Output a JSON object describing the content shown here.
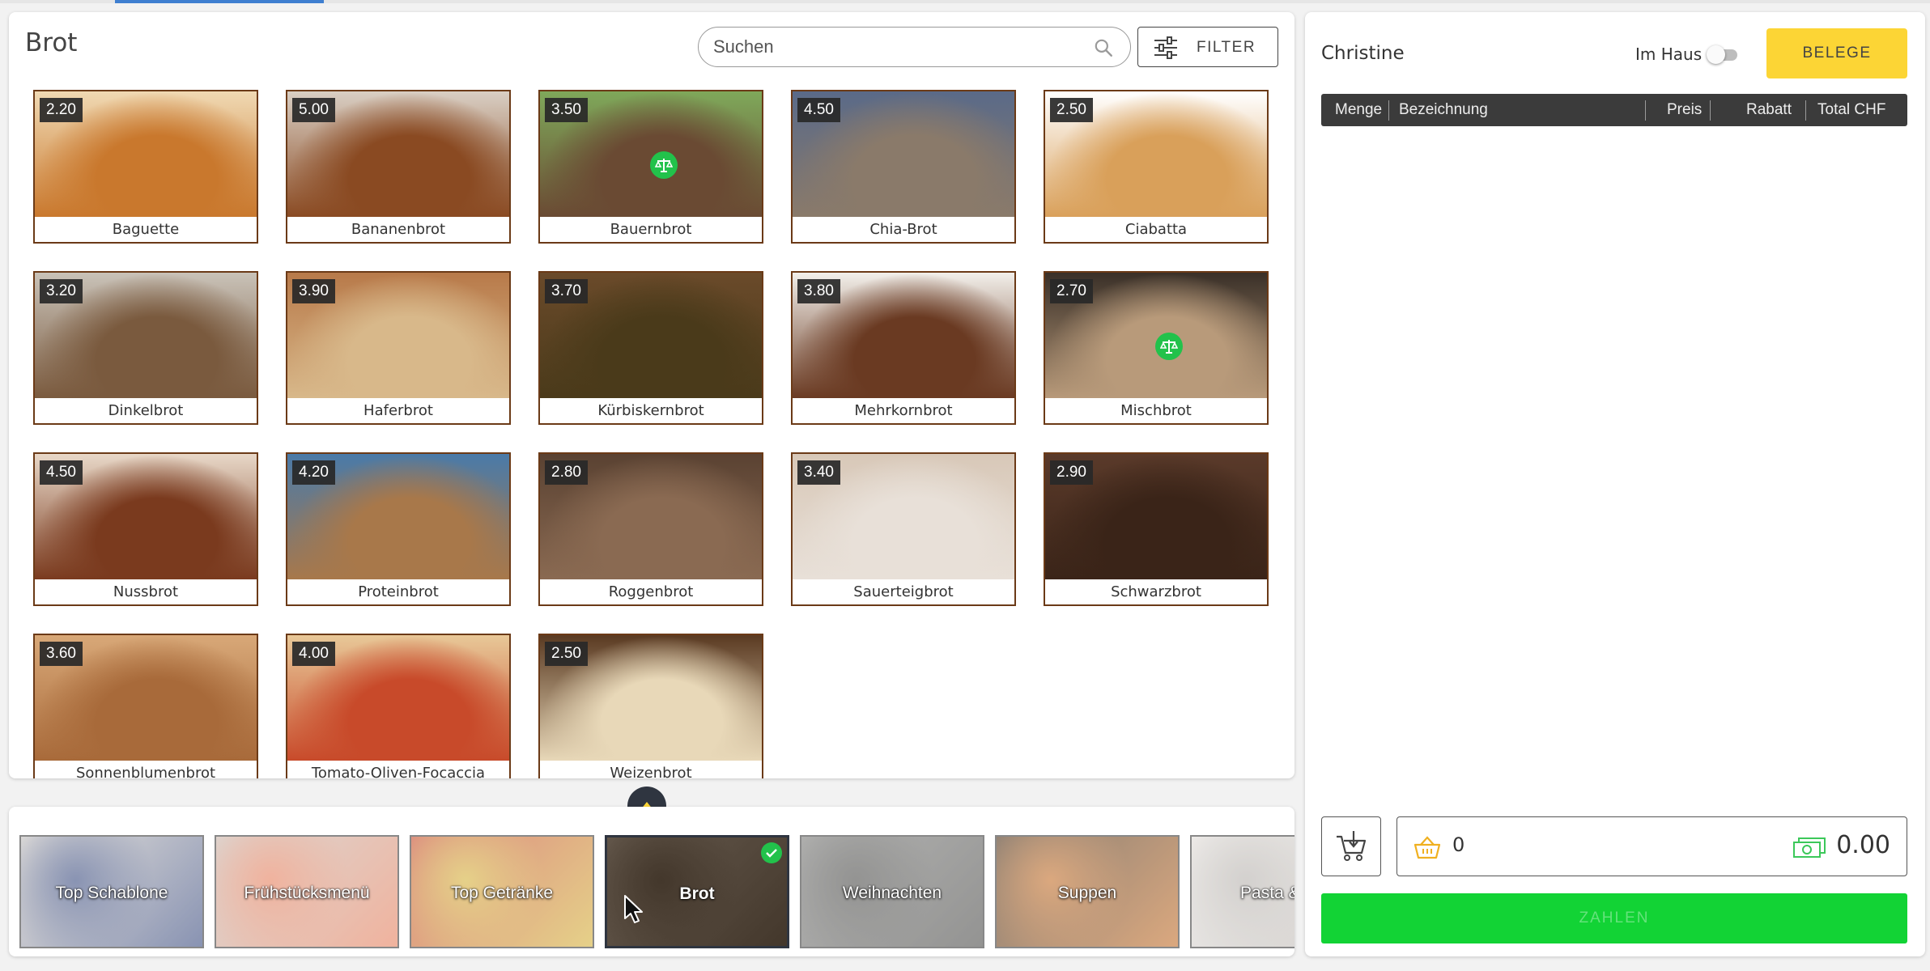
{
  "products_panel": {
    "category_title": "Brot",
    "search": {
      "placeholder": "Suchen",
      "value": ""
    },
    "filter_label": "FILTER",
    "products": [
      {
        "name": "Baguette",
        "price": "2.20",
        "weighed": false,
        "color_top": "#f0d9b3",
        "color_bottom": "#c9782d"
      },
      {
        "name": "Bananenbrot",
        "price": "5.00",
        "weighed": false,
        "color_top": "#d9cfc4",
        "color_bottom": "#8a4a22"
      },
      {
        "name": "Bauernbrot",
        "price": "3.50",
        "weighed": true,
        "color_top": "#7fa85a",
        "color_bottom": "#6a4a33"
      },
      {
        "name": "Chia-Brot",
        "price": "4.50",
        "weighed": false,
        "color_top": "#5a6a88",
        "color_bottom": "#8a7a6a"
      },
      {
        "name": "Ciabatta",
        "price": "2.50",
        "weighed": false,
        "color_top": "#ffffff",
        "color_bottom": "#d9a05a"
      },
      {
        "name": "Dinkelbrot",
        "price": "3.20",
        "weighed": false,
        "color_top": "#c9c2b8",
        "color_bottom": "#7a5a3e"
      },
      {
        "name": "Haferbrot",
        "price": "3.90",
        "weighed": false,
        "color_top": "#b87a4a",
        "color_bottom": "#d8b88a"
      },
      {
        "name": "Kürbiskernbrot",
        "price": "3.70",
        "weighed": false,
        "color_top": "#6a4a2a",
        "color_bottom": "#4a3a1a"
      },
      {
        "name": "Mehrkornbrot",
        "price": "3.80",
        "weighed": false,
        "color_top": "#f2efea",
        "color_bottom": "#6a3a22"
      },
      {
        "name": "Mischbrot",
        "price": "2.70",
        "weighed": true,
        "color_top": "#3a3028",
        "color_bottom": "#b89a7a"
      },
      {
        "name": "Nussbrot",
        "price": "4.50",
        "weighed": false,
        "color_top": "#e8d8c8",
        "color_bottom": "#7a3a1e"
      },
      {
        "name": "Proteinbrot",
        "price": "4.20",
        "weighed": false,
        "color_top": "#4a7aa8",
        "color_bottom": "#a8784a"
      },
      {
        "name": "Roggenbrot",
        "price": "2.80",
        "weighed": false,
        "color_top": "#5a4232",
        "color_bottom": "#8a6a52"
      },
      {
        "name": "Sauerteigbrot",
        "price": "3.40",
        "weighed": false,
        "color_top": "#d8c8b8",
        "color_bottom": "#e8e0d8"
      },
      {
        "name": "Schwarzbrot",
        "price": "2.90",
        "weighed": false,
        "color_top": "#5a3a2a",
        "color_bottom": "#3a2418"
      },
      {
        "name": "Sonnenblumenbrot",
        "price": "3.60",
        "weighed": false,
        "color_top": "#d8a878",
        "color_bottom": "#a86a3a"
      },
      {
        "name": "Tomato-Oliven-Focaccia",
        "price": "4.00",
        "weighed": false,
        "color_top": "#e8c898",
        "color_bottom": "#c84a2a"
      },
      {
        "name": "Weizenbrot",
        "price": "2.50",
        "weighed": false,
        "color_top": "#5a3a22",
        "color_bottom": "#e8d8b8"
      }
    ]
  },
  "categories": [
    {
      "label": "Top Schablone",
      "active": false,
      "color_a": "#d8d2c8",
      "color_b": "#4a5a8a"
    },
    {
      "label": "Frühstücksmenü",
      "active": false,
      "color_a": "#c8c2bc",
      "color_b": "#e88a6a"
    },
    {
      "label": "Top Getränke",
      "active": false,
      "color_a": "#c84a3a",
      "color_b": "#d8b84a"
    },
    {
      "label": "Brot",
      "active": true,
      "color_a": "#8a7a6a",
      "color_b": "#5a4a3a"
    },
    {
      "label": "Weihnachten",
      "active": false,
      "color_a": "#8a8a88",
      "color_b": "#5a5a58"
    },
    {
      "label": "Suppen",
      "active": false,
      "color_a": "#4a3a2a",
      "color_b": "#c87a3a"
    },
    {
      "label": "Pasta & Ve",
      "active": false,
      "color_a": "#e8e4e0",
      "color_b": "#bcb8b4"
    }
  ],
  "order": {
    "user_name": "Christine",
    "dine_in_label": "Im Haus",
    "dine_in_enabled": false,
    "receipts_label": "BELEGE",
    "columns": {
      "qty": "Menge",
      "description": "Bezeichnung",
      "price": "Preis",
      "discount": "Rabatt",
      "total": "Total CHF"
    },
    "lines": [],
    "item_count": "0",
    "total": "0.00",
    "pay_label": "ZAHLEN"
  },
  "colors": {
    "tile_border": "#6b3a17",
    "accent_yellow": "#fcd535",
    "pay_green": "#12d335",
    "weigh_badge_green": "#22c24b",
    "header_dark": "#3b3b3b"
  },
  "icons": {
    "search": "search-icon",
    "filter": "sliders-icon",
    "weighed_item": "scale-icon",
    "expand": "chevron-up-icon",
    "active_category": "check-icon",
    "save_cart": "cart-download-icon",
    "basket": "basket-icon",
    "cash": "cash-icon"
  }
}
